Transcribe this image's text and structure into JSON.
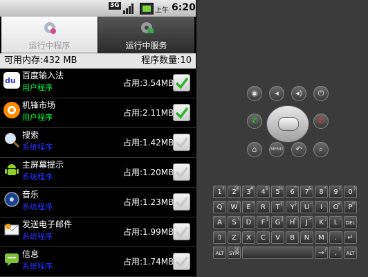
{
  "status_bar": {
    "network": "3G",
    "ampm": "上午",
    "time": "6:20"
  },
  "tabs": [
    {
      "label": "运行中程序",
      "active": true
    },
    {
      "label": "运行中服务",
      "active": false
    }
  ],
  "summary": {
    "available_memory": "可用内存:432 MB",
    "process_count": "程序数量:10"
  },
  "apps": [
    {
      "name": "百度输入法",
      "type": "用户程序",
      "memory": "占用:3.54MB",
      "checked": true,
      "icon": "baidu-icon"
    },
    {
      "name": "机锋市场",
      "type": "用户程序",
      "memory": "占用:2.11MB",
      "checked": true,
      "icon": "market-icon"
    },
    {
      "name": "搜索",
      "type": "系统程序",
      "memory": "占用:1.42MB",
      "checked": false,
      "icon": "search-icon"
    },
    {
      "name": "主屏幕提示",
      "type": "系统程序",
      "memory": "占用:1.20MB",
      "checked": false,
      "icon": "android-icon"
    },
    {
      "name": "音乐",
      "type": "系统程序",
      "memory": "占用:1.23MB",
      "checked": false,
      "icon": "music-icon"
    },
    {
      "name": "发送电子邮件",
      "type": "系统程序",
      "memory": "占用:1.99MB",
      "checked": false,
      "icon": "email-icon"
    },
    {
      "name": "信息",
      "type": "系统程序",
      "memory": "占用:1.74MB",
      "checked": false,
      "icon": "message-icon"
    }
  ],
  "colors": {
    "user_program": "#00ff40",
    "system_program": "#2a32ff"
  },
  "emulator": {
    "buttons_row1": [
      "camera",
      "volume-down",
      "volume-up",
      "power"
    ],
    "buttons_row3": [
      "home",
      "MENU",
      "back",
      "search"
    ],
    "keyboard": {
      "row1": [
        [
          "1",
          "!"
        ],
        [
          "2",
          "@"
        ],
        [
          "3",
          "#"
        ],
        [
          "4",
          "$"
        ],
        [
          "5",
          "%"
        ],
        [
          "6",
          "^"
        ],
        [
          "7",
          "&"
        ],
        [
          "8",
          "*"
        ],
        [
          "9",
          "("
        ],
        [
          "0",
          ")"
        ]
      ],
      "row2": [
        [
          "Q",
          "~"
        ],
        [
          "W",
          "\""
        ],
        [
          "E",
          "'"
        ],
        [
          "R",
          ""
        ],
        [
          "T",
          "{"
        ],
        [
          "Y",
          "}"
        ],
        [
          "U",
          "-"
        ],
        [
          "I",
          "_"
        ],
        [
          "O",
          "+"
        ],
        [
          "P",
          "="
        ]
      ],
      "row3": [
        [
          "A",
          ""
        ],
        [
          "S",
          "\\"
        ],
        [
          "D",
          ""
        ],
        [
          "F",
          "["
        ],
        [
          "G",
          "]"
        ],
        [
          "H",
          "<"
        ],
        [
          "J",
          ">"
        ],
        [
          "K",
          ";"
        ],
        [
          "L",
          ":"
        ],
        [
          "DEL",
          ""
        ]
      ],
      "row4": [
        [
          "⇧",
          ""
        ],
        [
          "Z",
          ""
        ],
        [
          "X",
          ""
        ],
        [
          "C",
          ""
        ],
        [
          "V",
          ""
        ],
        [
          "B",
          ""
        ],
        [
          "N",
          ""
        ],
        [
          "M",
          ""
        ],
        [
          ".",
          ""
        ],
        [
          "↵",
          ""
        ]
      ],
      "row5": [
        [
          "ALT",
          ""
        ],
        [
          "SYM",
          "@"
        ],
        [
          "",
          ""
        ],
        [
          "",
          ""
        ],
        [
          "",
          ""
        ],
        [
          "",
          ""
        ],
        [
          "",
          ""
        ],
        [
          "→",
          "/"
        ],
        [
          ",",
          "?"
        ],
        [
          "ALT",
          ""
        ]
      ]
    }
  }
}
